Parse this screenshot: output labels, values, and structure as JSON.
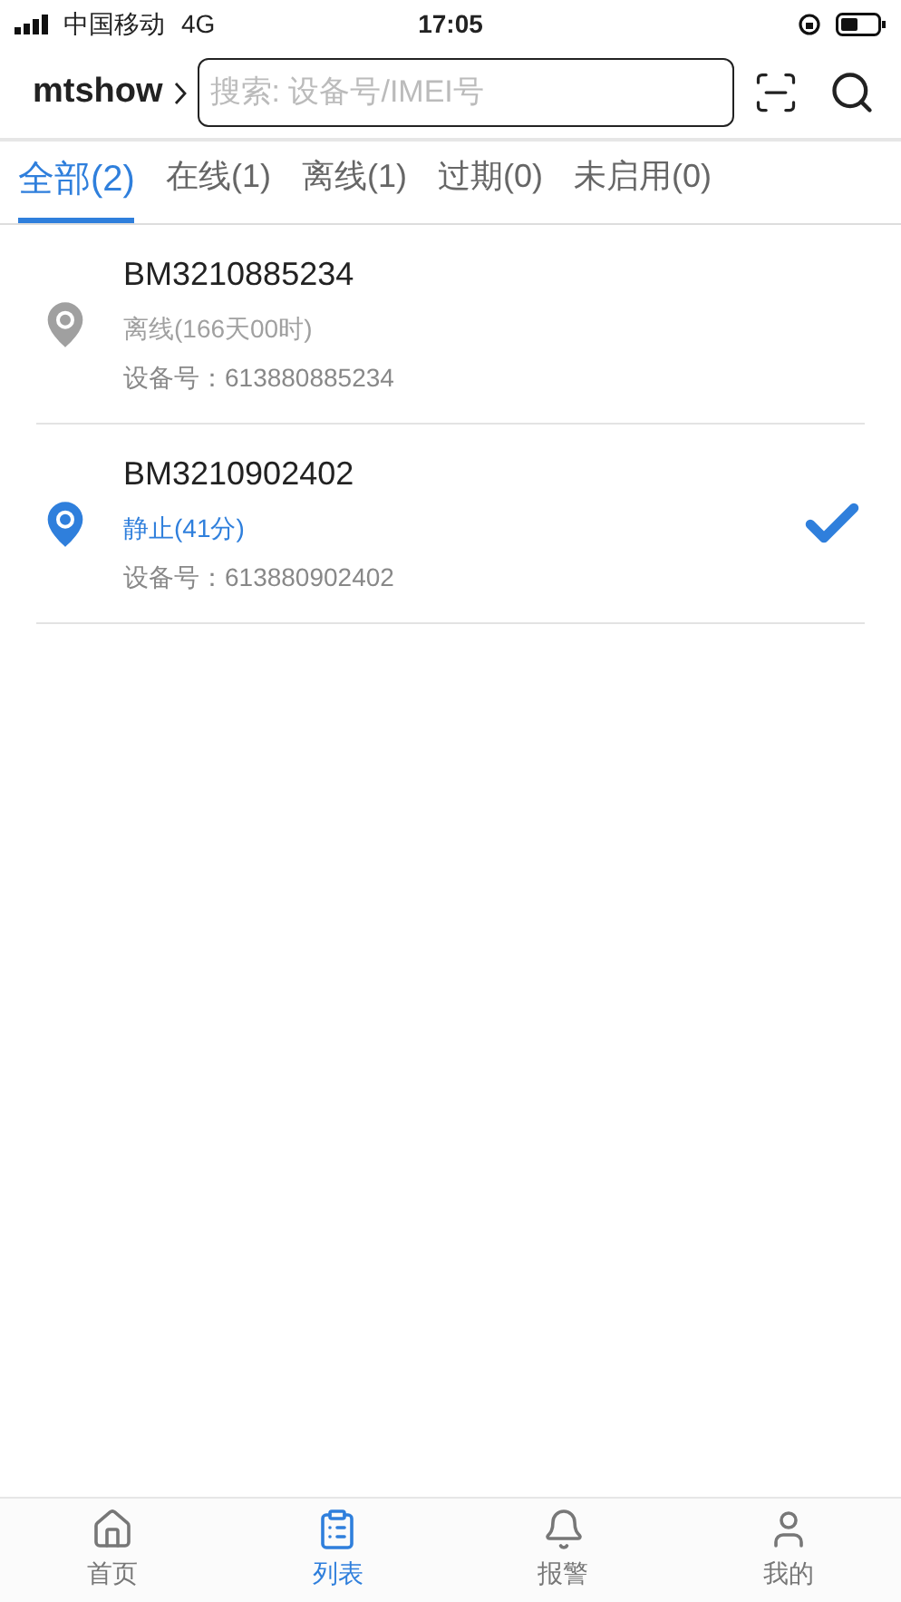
{
  "status_bar": {
    "carrier": "中国移动",
    "network": "4G",
    "time": "17:05"
  },
  "header": {
    "account": "mtshow",
    "search": {
      "placeholder": "搜索: 设备号/IMEI号"
    }
  },
  "tabs": [
    {
      "label": "全部(2)",
      "selected": true
    },
    {
      "label": "在线(1)",
      "selected": false
    },
    {
      "label": "离线(1)",
      "selected": false
    },
    {
      "label": "过期(0)",
      "selected": false
    },
    {
      "label": "未启用(0)",
      "selected": false
    }
  ],
  "devices": [
    {
      "name": "BM3210885234",
      "status": "离线(166天00时)",
      "color": "#a0a0a0",
      "device_no": "设备号：613880885234",
      "selected": false
    },
    {
      "name": "BM3210902402",
      "status": "静止(41分)",
      "color": "#2f7fdc",
      "device_no": "设备号：613880902402",
      "selected": true
    }
  ],
  "bottom_nav": [
    {
      "kind": "home",
      "label": "首页",
      "selected": false
    },
    {
      "kind": "list",
      "label": "列表",
      "selected": true
    },
    {
      "kind": "alarm",
      "label": "报警",
      "selected": false
    },
    {
      "kind": "user",
      "label": "我的",
      "selected": false
    }
  ]
}
